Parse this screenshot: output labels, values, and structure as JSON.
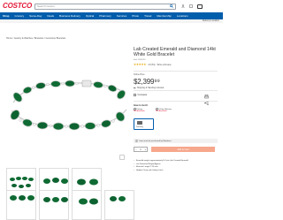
{
  "header": {
    "logo": "COSTCO",
    "logo_sub": "WHOLESALE",
    "search_placeholder": "Search Costco",
    "links": [
      "Sign In / Register",
      "Orders & Returns",
      "Cart"
    ]
  },
  "nav": {
    "items": [
      "Shop",
      "Grocery",
      "Same-Day",
      "Deals",
      "Business Delivery",
      "Optical",
      "Pharmacy",
      "Services",
      "Photo",
      "Travel",
      "Membership",
      "Locations"
    ]
  },
  "substrip": {
    "text": "Delivery Location"
  },
  "breadcrumb": "Home / Jewelry & Watches / Bracelets / Gemstone Bracelets",
  "product": {
    "title": "Lab Created Emerald and Diamond 14kt White Gold Bracelet",
    "item_no": "Item 1462023",
    "rating_count": "4.8 (54)",
    "rating_extra": "Write a Review",
    "price_label": "Online Price",
    "price": "$2,399⁹⁹",
    "shipping": "Shipping & Handling Included",
    "compare": "Compare"
  },
  "fulfillment": {
    "heading": "How to Get It",
    "options": [
      {
        "label": "Pickup",
        "status": "Not Available"
      },
      {
        "label": "2-Day Delivery",
        "status": "Not Available"
      }
    ],
    "delivery_label": "Delivery"
  },
  "member_bar": "Item must be purchased by Members.",
  "qty": {
    "value": "1"
  },
  "add_button": "Add to Cart",
  "features": [
    "Emerald weighs approximately 8.4 ctw Lab Created Emerald",
    "ctw Diamond Weight Approx",
    "Bracelet Length 7.25 inch",
    "Hidden Clasp with Safety Latch"
  ],
  "colors": {
    "brand_red": "#e31837",
    "brand_blue": "#005dab",
    "button": "#f6a78c"
  }
}
